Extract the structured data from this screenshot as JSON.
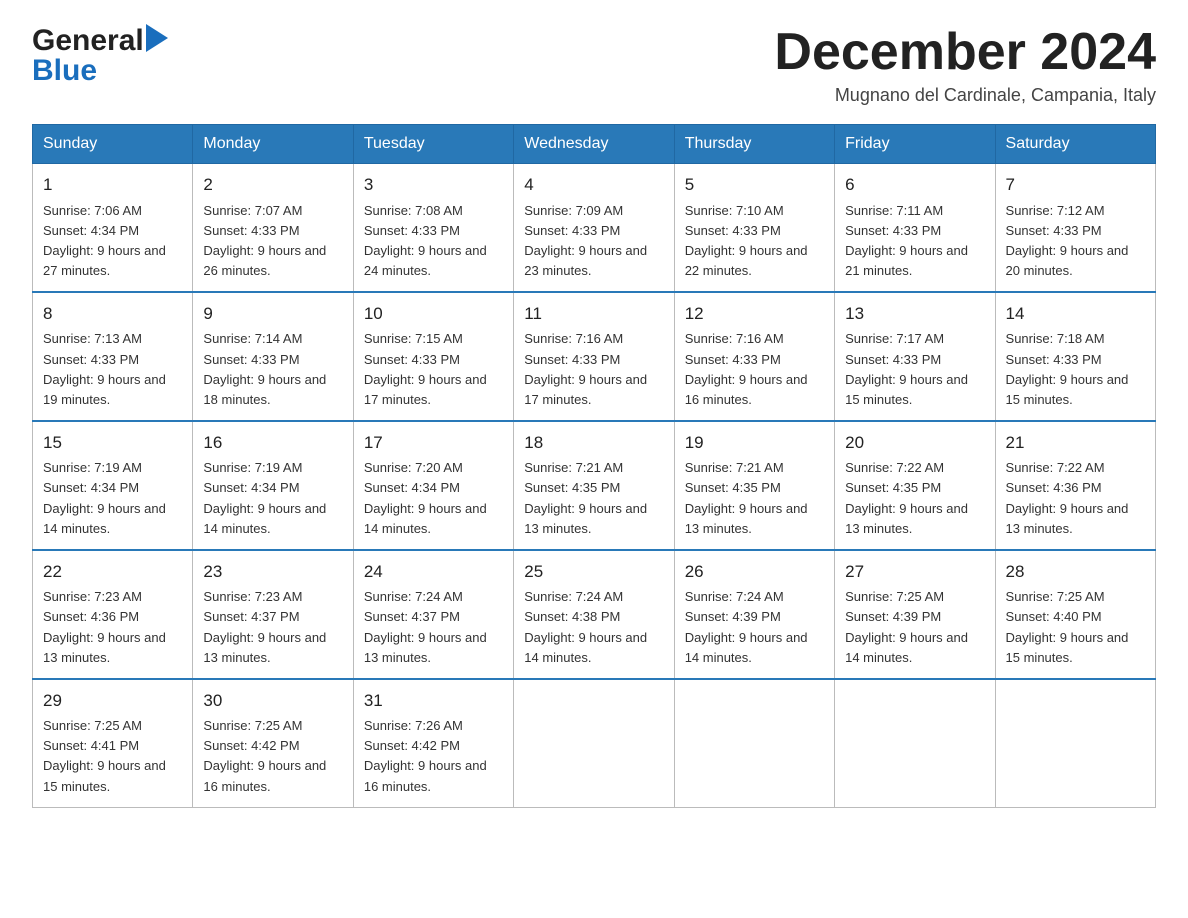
{
  "header": {
    "logo_general": "General",
    "logo_blue": "Blue",
    "month_title": "December 2024",
    "location": "Mugnano del Cardinale, Campania, Italy"
  },
  "days_of_week": [
    "Sunday",
    "Monday",
    "Tuesday",
    "Wednesday",
    "Thursday",
    "Friday",
    "Saturday"
  ],
  "weeks": [
    [
      {
        "day": "1",
        "sunrise": "Sunrise: 7:06 AM",
        "sunset": "Sunset: 4:34 PM",
        "daylight": "Daylight: 9 hours and 27 minutes."
      },
      {
        "day": "2",
        "sunrise": "Sunrise: 7:07 AM",
        "sunset": "Sunset: 4:33 PM",
        "daylight": "Daylight: 9 hours and 26 minutes."
      },
      {
        "day": "3",
        "sunrise": "Sunrise: 7:08 AM",
        "sunset": "Sunset: 4:33 PM",
        "daylight": "Daylight: 9 hours and 24 minutes."
      },
      {
        "day": "4",
        "sunrise": "Sunrise: 7:09 AM",
        "sunset": "Sunset: 4:33 PM",
        "daylight": "Daylight: 9 hours and 23 minutes."
      },
      {
        "day": "5",
        "sunrise": "Sunrise: 7:10 AM",
        "sunset": "Sunset: 4:33 PM",
        "daylight": "Daylight: 9 hours and 22 minutes."
      },
      {
        "day": "6",
        "sunrise": "Sunrise: 7:11 AM",
        "sunset": "Sunset: 4:33 PM",
        "daylight": "Daylight: 9 hours and 21 minutes."
      },
      {
        "day": "7",
        "sunrise": "Sunrise: 7:12 AM",
        "sunset": "Sunset: 4:33 PM",
        "daylight": "Daylight: 9 hours and 20 minutes."
      }
    ],
    [
      {
        "day": "8",
        "sunrise": "Sunrise: 7:13 AM",
        "sunset": "Sunset: 4:33 PM",
        "daylight": "Daylight: 9 hours and 19 minutes."
      },
      {
        "day": "9",
        "sunrise": "Sunrise: 7:14 AM",
        "sunset": "Sunset: 4:33 PM",
        "daylight": "Daylight: 9 hours and 18 minutes."
      },
      {
        "day": "10",
        "sunrise": "Sunrise: 7:15 AM",
        "sunset": "Sunset: 4:33 PM",
        "daylight": "Daylight: 9 hours and 17 minutes."
      },
      {
        "day": "11",
        "sunrise": "Sunrise: 7:16 AM",
        "sunset": "Sunset: 4:33 PM",
        "daylight": "Daylight: 9 hours and 17 minutes."
      },
      {
        "day": "12",
        "sunrise": "Sunrise: 7:16 AM",
        "sunset": "Sunset: 4:33 PM",
        "daylight": "Daylight: 9 hours and 16 minutes."
      },
      {
        "day": "13",
        "sunrise": "Sunrise: 7:17 AM",
        "sunset": "Sunset: 4:33 PM",
        "daylight": "Daylight: 9 hours and 15 minutes."
      },
      {
        "day": "14",
        "sunrise": "Sunrise: 7:18 AM",
        "sunset": "Sunset: 4:33 PM",
        "daylight": "Daylight: 9 hours and 15 minutes."
      }
    ],
    [
      {
        "day": "15",
        "sunrise": "Sunrise: 7:19 AM",
        "sunset": "Sunset: 4:34 PM",
        "daylight": "Daylight: 9 hours and 14 minutes."
      },
      {
        "day": "16",
        "sunrise": "Sunrise: 7:19 AM",
        "sunset": "Sunset: 4:34 PM",
        "daylight": "Daylight: 9 hours and 14 minutes."
      },
      {
        "day": "17",
        "sunrise": "Sunrise: 7:20 AM",
        "sunset": "Sunset: 4:34 PM",
        "daylight": "Daylight: 9 hours and 14 minutes."
      },
      {
        "day": "18",
        "sunrise": "Sunrise: 7:21 AM",
        "sunset": "Sunset: 4:35 PM",
        "daylight": "Daylight: 9 hours and 13 minutes."
      },
      {
        "day": "19",
        "sunrise": "Sunrise: 7:21 AM",
        "sunset": "Sunset: 4:35 PM",
        "daylight": "Daylight: 9 hours and 13 minutes."
      },
      {
        "day": "20",
        "sunrise": "Sunrise: 7:22 AM",
        "sunset": "Sunset: 4:35 PM",
        "daylight": "Daylight: 9 hours and 13 minutes."
      },
      {
        "day": "21",
        "sunrise": "Sunrise: 7:22 AM",
        "sunset": "Sunset: 4:36 PM",
        "daylight": "Daylight: 9 hours and 13 minutes."
      }
    ],
    [
      {
        "day": "22",
        "sunrise": "Sunrise: 7:23 AM",
        "sunset": "Sunset: 4:36 PM",
        "daylight": "Daylight: 9 hours and 13 minutes."
      },
      {
        "day": "23",
        "sunrise": "Sunrise: 7:23 AM",
        "sunset": "Sunset: 4:37 PM",
        "daylight": "Daylight: 9 hours and 13 minutes."
      },
      {
        "day": "24",
        "sunrise": "Sunrise: 7:24 AM",
        "sunset": "Sunset: 4:37 PM",
        "daylight": "Daylight: 9 hours and 13 minutes."
      },
      {
        "day": "25",
        "sunrise": "Sunrise: 7:24 AM",
        "sunset": "Sunset: 4:38 PM",
        "daylight": "Daylight: 9 hours and 14 minutes."
      },
      {
        "day": "26",
        "sunrise": "Sunrise: 7:24 AM",
        "sunset": "Sunset: 4:39 PM",
        "daylight": "Daylight: 9 hours and 14 minutes."
      },
      {
        "day": "27",
        "sunrise": "Sunrise: 7:25 AM",
        "sunset": "Sunset: 4:39 PM",
        "daylight": "Daylight: 9 hours and 14 minutes."
      },
      {
        "day": "28",
        "sunrise": "Sunrise: 7:25 AM",
        "sunset": "Sunset: 4:40 PM",
        "daylight": "Daylight: 9 hours and 15 minutes."
      }
    ],
    [
      {
        "day": "29",
        "sunrise": "Sunrise: 7:25 AM",
        "sunset": "Sunset: 4:41 PM",
        "daylight": "Daylight: 9 hours and 15 minutes."
      },
      {
        "day": "30",
        "sunrise": "Sunrise: 7:25 AM",
        "sunset": "Sunset: 4:42 PM",
        "daylight": "Daylight: 9 hours and 16 minutes."
      },
      {
        "day": "31",
        "sunrise": "Sunrise: 7:26 AM",
        "sunset": "Sunset: 4:42 PM",
        "daylight": "Daylight: 9 hours and 16 minutes."
      },
      null,
      null,
      null,
      null
    ]
  ]
}
